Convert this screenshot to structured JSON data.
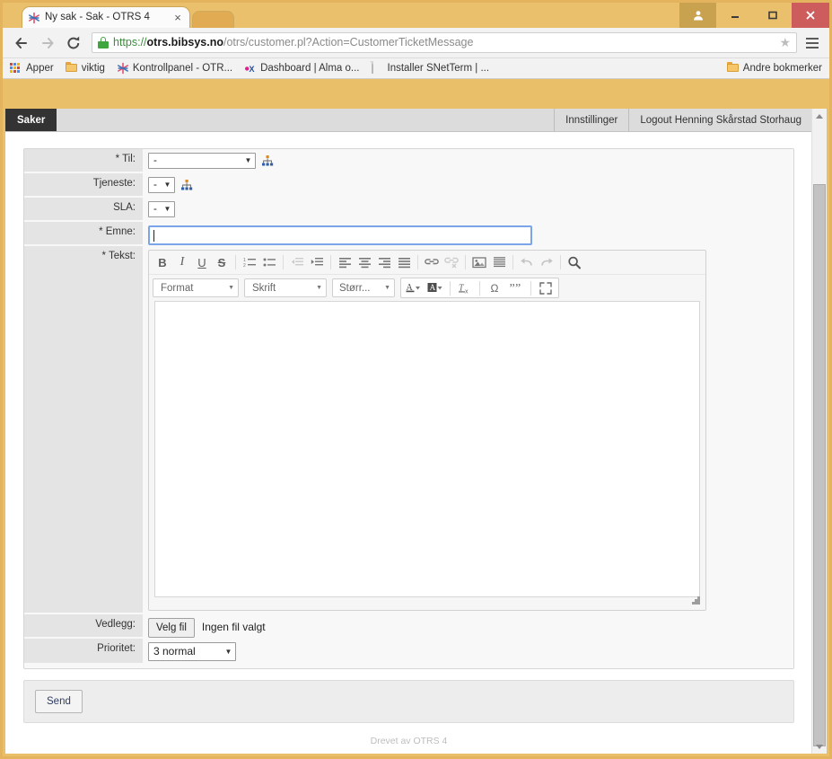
{
  "browser": {
    "tab": {
      "title": "Ny sak - Sak - OTRS 4",
      "close_label": "×",
      "favicon": "otrs-star-icon"
    },
    "url": {
      "scheme": "https://",
      "host": "otrs.bibsys.no",
      "path": "/otrs/customer.pl?Action=CustomerTicketMessage"
    },
    "nav": {
      "back": "←",
      "forward": "→",
      "reload": "⟳",
      "star": "★"
    },
    "bookmarks": [
      {
        "label": "Apper",
        "icon": "apps-grid-icon"
      },
      {
        "label": "viktig",
        "icon": "folder-icon"
      },
      {
        "label": "Kontrollpanel - OTR...",
        "icon": "otrs-star-icon"
      },
      {
        "label": "Dashboard | Alma o...",
        "icon": "alma-ex-icon"
      },
      {
        "label": "Installer SNetTerm | ...",
        "icon": "page-icon"
      }
    ],
    "other_bookmarks": {
      "label": "Andre bokmerker",
      "icon": "folder-icon"
    }
  },
  "otrs": {
    "nav": {
      "saker": "Saker",
      "innstillinger": "Innstillinger",
      "logout": "Logout Henning Skårstad Storhaug"
    },
    "form": {
      "til": {
        "label": "* Til:",
        "value": "-"
      },
      "tjeneste": {
        "label": "Tjeneste:",
        "value": "-"
      },
      "sla": {
        "label": "SLA:",
        "value": "-"
      },
      "emne": {
        "label": "* Emne:",
        "value": "",
        "placeholder": ""
      },
      "tekst": {
        "label": "* Tekst:",
        "value": ""
      },
      "vedlegg": {
        "label": "Vedlegg:",
        "button": "Velg fil",
        "status": "Ingen fil valgt"
      },
      "prioritet": {
        "label": "Prioritet:",
        "value": "3 normal"
      }
    },
    "editor": {
      "dropdowns": [
        {
          "name": "format",
          "label": "Format"
        },
        {
          "name": "font",
          "label": "Skrift"
        },
        {
          "name": "size",
          "label": "Størr..."
        }
      ],
      "row1_buttons": [
        "bold",
        "italic",
        "underline",
        "strikethrough",
        "numbered-list",
        "bulleted-list",
        "outdent",
        "indent",
        "align-left",
        "align-center",
        "align-right",
        "align-justify",
        "link",
        "unlink",
        "image",
        "source",
        "undo",
        "redo",
        "find"
      ],
      "row2_buttons": [
        "text-color",
        "background-color",
        "remove-format",
        "special-character",
        "blockquote",
        "maximize"
      ],
      "bold_glyph": "B",
      "italic_glyph": "I",
      "underline_glyph": "U",
      "strike_glyph": "S",
      "color_glyph": "A",
      "removeformat_glyph": "T",
      "omega_glyph": "Ω",
      "quote_glyph": "֖֖",
      "search_glyph": "⌕"
    },
    "send_button": "Send",
    "footer": "Drevet av OTRS 4"
  },
  "colors": {
    "window_frame": "#e9bf6a",
    "close_button": "#cd5c5c",
    "nav_active": "#333333",
    "focus_border": "#7aa5e8",
    "lock_green": "#41a53f",
    "link_text": "#2d3e63"
  }
}
